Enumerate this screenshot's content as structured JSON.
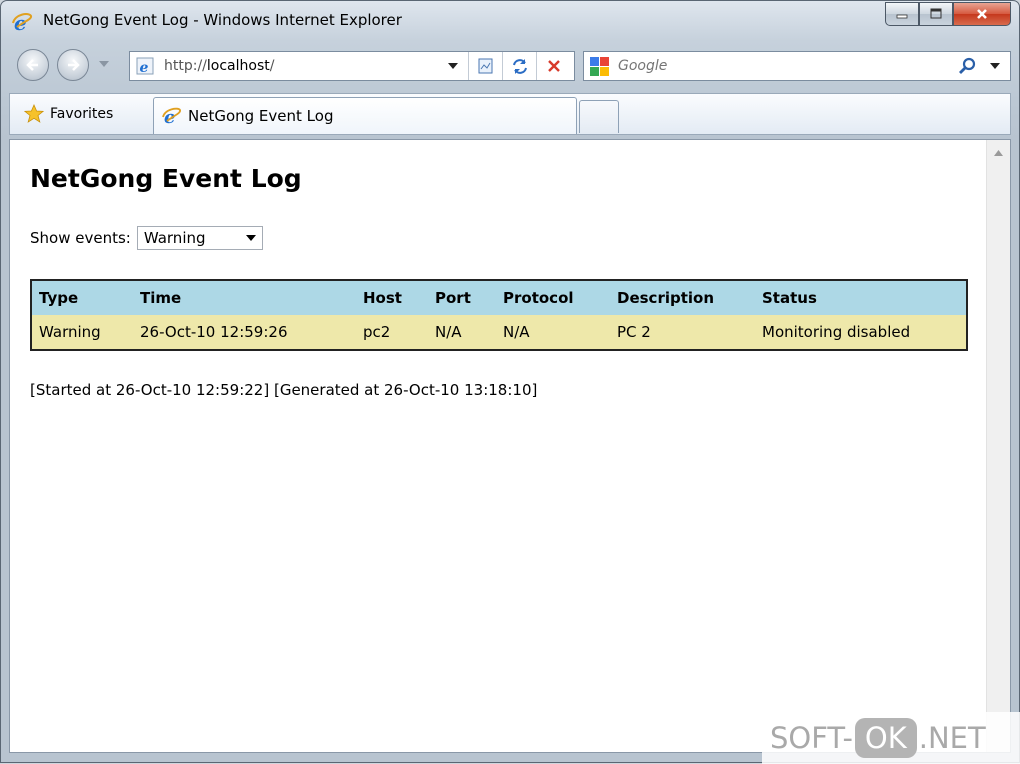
{
  "window": {
    "title": "NetGong Event Log - Windows Internet Explorer"
  },
  "nav": {
    "address_prefix": "http://",
    "address_host": "localhost",
    "address_suffix": "/",
    "search_placeholder": "Google"
  },
  "tabs": {
    "favorites_label": "Favorites",
    "active_tab_label": "NetGong Event Log"
  },
  "page": {
    "heading": "NetGong Event Log",
    "filter_label": "Show events:",
    "filter_selected": "Warning",
    "table": {
      "headers": [
        "Type",
        "Time",
        "Host",
        "Port",
        "Protocol",
        "Description",
        "Status"
      ],
      "rows": [
        [
          "Warning",
          "26-Oct-10 12:59:26",
          "pc2",
          "N/A",
          "N/A",
          "PC 2",
          "Monitoring disabled"
        ]
      ]
    },
    "footer": "[Started at 26-Oct-10 12:59:22] [Generated at 26-Oct-10 13:18:10]"
  },
  "watermark": {
    "part1": "SOFT-",
    "part2": "OK",
    "part3": ".NET"
  },
  "colors": {
    "header_bg": "#add8e6",
    "row_bg": "#eee8aa",
    "close_button": "#c5381d"
  }
}
